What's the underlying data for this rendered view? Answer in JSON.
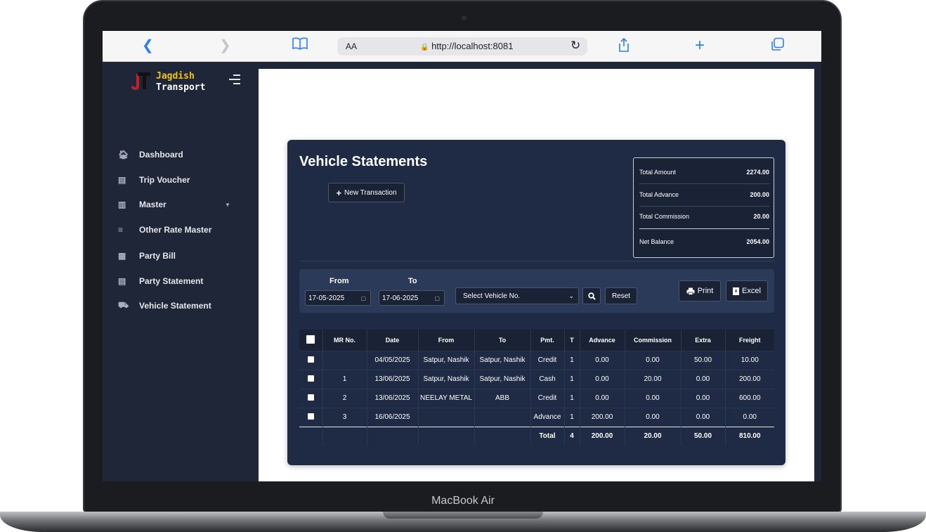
{
  "device": {
    "bezel_label": "MacBook Air"
  },
  "browser": {
    "back_icon": "chevron-left-icon",
    "forward_icon": "chevron-right-icon",
    "bookmarks_icon": "book-icon",
    "reader_label": "AA",
    "url": "http://localhost:8081",
    "reload_icon": "reload-icon",
    "share_icon": "share-icon",
    "new_tab_icon": "plus-icon",
    "tabs_icon": "tabs-icon"
  },
  "brand": {
    "line1": "Jagdish",
    "line2": "Transport",
    "accent": "#f0c419",
    "mark_color": "#c0202a"
  },
  "sidebar": {
    "items": [
      {
        "label": "Dashboard",
        "icon": "home-icon"
      },
      {
        "label": "Trip Voucher",
        "icon": "ticket-icon"
      },
      {
        "label": "Master",
        "icon": "database-icon"
      },
      {
        "label": "Other Rate Master",
        "icon": "sliders-icon"
      },
      {
        "label": "Party Bill",
        "icon": "bill-icon"
      },
      {
        "label": "Party Statement",
        "icon": "document-icon"
      },
      {
        "label": "Vehicle Statement",
        "icon": "truck-icon"
      }
    ]
  },
  "page": {
    "title": "Vehicle Statements",
    "new_transaction_label": "New Transaction"
  },
  "summary": {
    "rows": [
      {
        "label": "Total Amount",
        "value": "2274.00"
      },
      {
        "label": "Total Advance",
        "value": "200.00"
      },
      {
        "label": "Total Commission",
        "value": "20.00"
      },
      {
        "label": "Net Balance",
        "value": "2054.00"
      }
    ]
  },
  "filter": {
    "from_label": "From",
    "to_label": "To",
    "from_value": "17-05-2025",
    "to_value": "17-06-2025",
    "vehicle_placeholder": "Select Vehicle No.",
    "reset_label": "Reset",
    "print_label": "Print",
    "excel_label": "Excel"
  },
  "table": {
    "headers": [
      "MR No.",
      "Date",
      "From",
      "To",
      "Pmt.",
      "T",
      "Advance",
      "Commission",
      "Extra",
      "Freight"
    ],
    "rows": [
      [
        "",
        "04/05/2025",
        "Satpur, Nashik",
        "Satpur, Nashik",
        "Credit",
        "1",
        "0.00",
        "0.00",
        "50.00",
        "10.00"
      ],
      [
        "1",
        "13/06/2025",
        "Satpur, Nashik",
        "Satpur, Nashik",
        "Cash",
        "1",
        "0.00",
        "20.00",
        "0.00",
        "200.00"
      ],
      [
        "2",
        "13/06/2025",
        "NEELAY METAL",
        "ABB",
        "Credit",
        "1",
        "0.00",
        "0.00",
        "0.00",
        "600.00"
      ],
      [
        "3",
        "16/06/2025",
        "",
        "",
        "Advance",
        "1",
        "200.00",
        "0.00",
        "0.00",
        "0.00"
      ]
    ],
    "totals": {
      "label": "Total",
      "t": "4",
      "advance": "200.00",
      "commission": "20.00",
      "extra": "50.00",
      "freight": "810.00"
    }
  }
}
